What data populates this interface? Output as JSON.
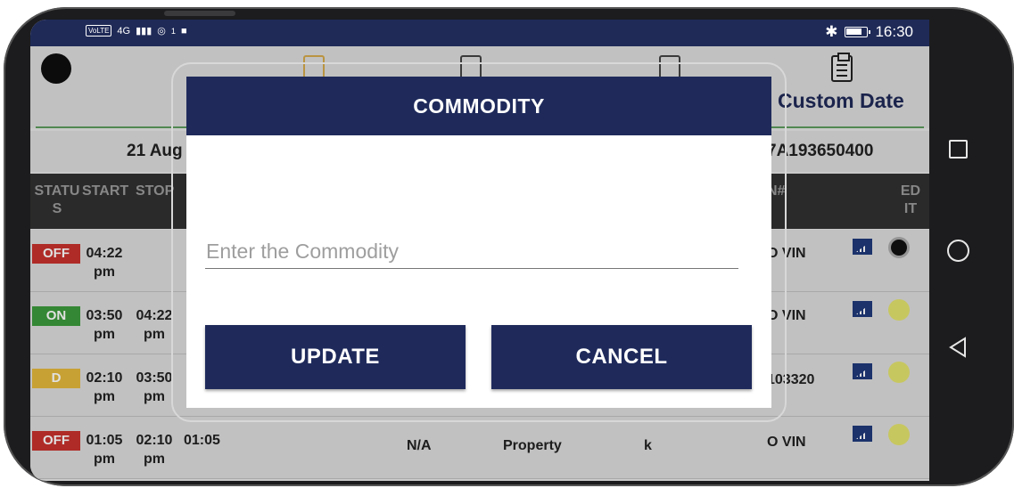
{
  "statusbar": {
    "network_badge": "VoLTE",
    "network_type": "4G",
    "hotspot_count": "1",
    "time": "16:30"
  },
  "app": {
    "header_tab_label": "Custom Date",
    "date_text": "21 Aug",
    "vin_text": "7A193650400"
  },
  "table": {
    "headers": {
      "status": "STATU S",
      "start": "START",
      "stop": "STOP",
      "vin": "N#",
      "edit": "ED IT"
    },
    "rows": [
      {
        "status": "OFF",
        "status_color": "#c8322d",
        "start": "04:22 pm",
        "stop": "",
        "vin": "O VIN",
        "dot_color": "#111111"
      },
      {
        "status": "ON",
        "status_color": "#3c9a3c",
        "start": "03:50 pm",
        "stop": "04:22 pm",
        "vin": "O VIN",
        "dot_color": "#e3e36e"
      },
      {
        "status": "D",
        "status_color": "#e4b83c",
        "start": "02:10 pm",
        "stop": "03:50 pm",
        "vin": "103320",
        "dot_color": "#e3e36e"
      },
      {
        "status": "OFF",
        "status_color": "#c8322d",
        "start": "01:05 pm",
        "stop": "02:10 pm",
        "duration": "01:05",
        "location": "N/A",
        "type": "Property",
        "unit": "k",
        "vin": "O VIN",
        "dot_color": "#e3e36e"
      }
    ]
  },
  "dialog": {
    "title": "COMMODITY",
    "input_placeholder": "Enter the Commodity",
    "input_value": "",
    "update_label": "UPDATE",
    "cancel_label": "CANCEL"
  },
  "colors": {
    "primary": "#1f2a5b",
    "status_off": "#c8322d",
    "status_on": "#3c9a3c",
    "status_driving": "#e4b83c"
  }
}
